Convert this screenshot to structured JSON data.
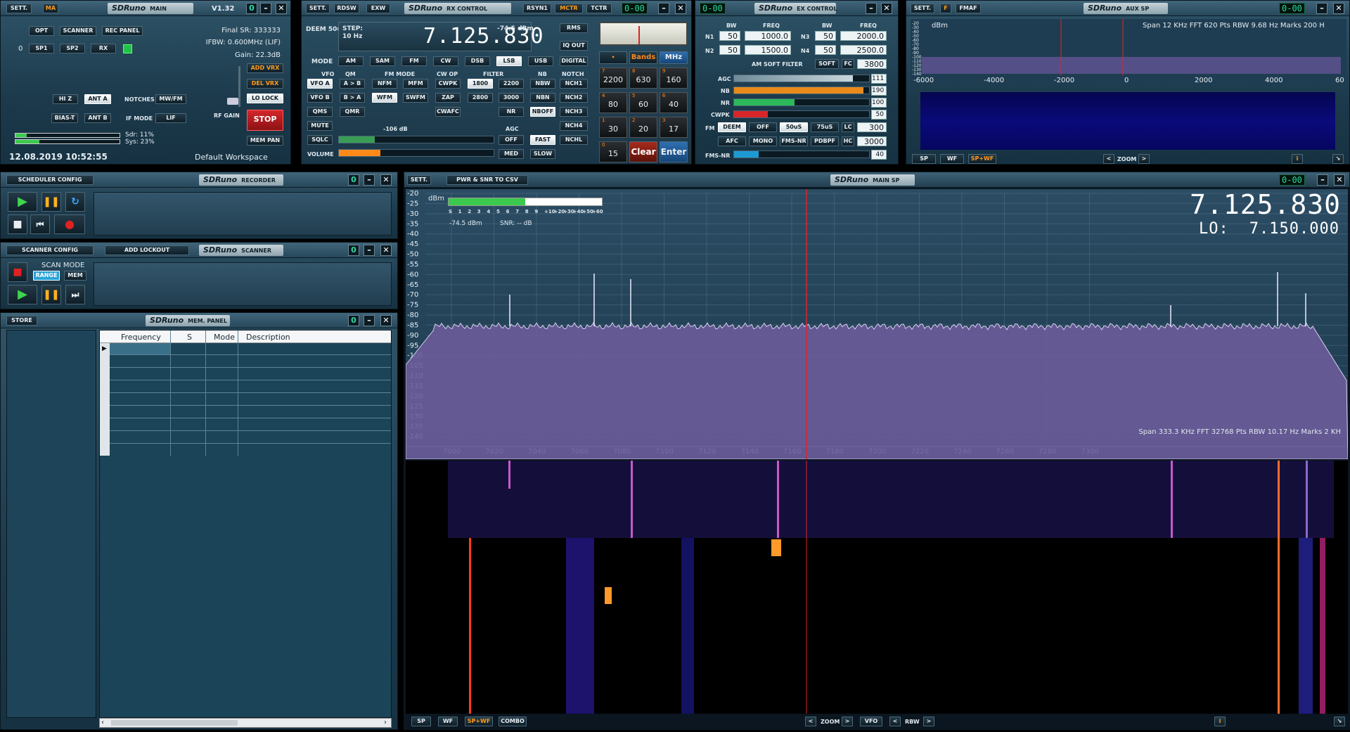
{
  "main": {
    "sett": "SETT.",
    "ma": "MA",
    "logo": "SDRuno",
    "title": "MAIN",
    "version": "V1.32",
    "opt": "OPT",
    "scanner": "SCANNER",
    "rec_panel": "REC PANEL",
    "num0": "0",
    "sp1": "SP1",
    "sp2": "SP2",
    "rx": "RX",
    "final_sr": "Final SR: 333333",
    "ifbw": "IFBW: 0.600MHz (LIF)",
    "gain": "Gain: 22.3dB",
    "add_vrx": "ADD VRX",
    "del_vrx": "DEL VRX",
    "lo_lock": "LO LOCK",
    "hiz": "HI Z",
    "ant_a": "ANT A",
    "notches": "NOTCHES",
    "mwfm": "MW/FM",
    "bias_t": "BIAS-T",
    "ant_b": "ANT B",
    "if_mode": "IF MODE",
    "lif": "LIF",
    "rf_gain": "RF GAIN",
    "stop": "STOP",
    "mem_pan": "MEM PAN",
    "sdr": "Sdr: 11%",
    "sys": "Sys: 23%",
    "sdr_level": 0.11,
    "sys_level": 0.23,
    "datetime": "12.08.2019 10:52:55",
    "workspace": "Default Workspace"
  },
  "rx": {
    "sett": "SETT.",
    "rdsw": "RDSW",
    "exw": "EXW",
    "logo": "SDRuno",
    "title": "RX CONTROL",
    "rsyn1": "RSYN1",
    "mctr": "MCTR",
    "tctr": "TCTR",
    "lcd": "0-00",
    "deem": "DEEM 50u",
    "step": "STEP:",
    "step_val": "10 Hz",
    "freq": "7.125.830",
    "dbm": "-74.5 dBm",
    "rms": "RMS",
    "iq_out": "IQ OUT",
    "mode": "MODE",
    "modes": [
      "AM",
      "SAM",
      "FM",
      "CW",
      "DSB",
      "LSB",
      "USB",
      "DIGITAL"
    ],
    "vfo": "VFO",
    "qm": "QM",
    "fm_mode": "FM MODE",
    "cw_op": "CW OP",
    "filter": "FILTER",
    "nb": "NB",
    "notch": "NOTCH",
    "vfo_a": "VFO A",
    "a_b": "A > B",
    "nfm": "NFM",
    "mfm": "MFM",
    "cwpk": "CWPK",
    "f1800": "1800",
    "f2200": "2200",
    "nbw": "NBW",
    "nch1": "NCH1",
    "vfo_b": "VFO B",
    "b_a": "B > A",
    "wfm": "WFM",
    "swfm": "SWFM",
    "zap": "ZAP",
    "f2800": "2800",
    "f3000": "3000",
    "nbn": "NBN",
    "nch2": "NCH2",
    "qms": "QMS",
    "qmr": "QMR",
    "cwafc": "CWAFC",
    "nr": "NR",
    "nboff": "NBOFF",
    "nch3": "NCH3",
    "mute": "MUTE",
    "sqlc_db": "-106 dB",
    "agc": "AGC",
    "nch4": "NCH4",
    "sqlc": "SQLC",
    "off": "OFF",
    "fast": "FAST",
    "nchl": "NCHL",
    "volume": "VOLUME",
    "med": "MED",
    "slow": "SLOW",
    "sqlc_level": 0.23,
    "volume_level": 0.27,
    "bands": "Bands",
    "mhz": "MHz",
    "keys": [
      {
        "k": "2200",
        "n": "7"
      },
      {
        "k": "630",
        "n": "8"
      },
      {
        "k": "160",
        "n": "9"
      },
      {
        "k": "80",
        "n": "4"
      },
      {
        "k": "60",
        "n": "5"
      },
      {
        "k": "40",
        "n": "6"
      },
      {
        "k": "30",
        "n": "1"
      },
      {
        "k": "20",
        "n": "2"
      },
      {
        "k": "17",
        "n": "3"
      },
      {
        "k": "15",
        "n": "0"
      }
    ],
    "clear": "Clear",
    "enter": "Enter"
  },
  "ex": {
    "lcd": "0-00",
    "logo": "SDRuno",
    "title": "EX CONTROL",
    "bw": "BW",
    "freq": "FREQ",
    "n1": "N1",
    "n1_bw": "50",
    "n1_freq": "1000.0",
    "n3": "N3",
    "n3_bw": "50",
    "n3_freq": "2000.0",
    "n2": "N2",
    "n2_bw": "50",
    "n2_freq": "1500.0",
    "n4": "N4",
    "n4_bw": "50",
    "n4_freq": "2500.0",
    "am_soft": "AM SOFT FILTER",
    "soft": "SOFT",
    "fc": "FC",
    "fc_val": "3800",
    "agc": "AGC",
    "agc_val": "111",
    "agc_level": 0.88,
    "nb": "NB",
    "nb_val": "190",
    "nb_level": 0.96,
    "nr": "NR",
    "nr_val": "100",
    "nr_level": 0.45,
    "cwpk": "CWPK",
    "cwpk_val": "50",
    "cwpk_level": 0.25,
    "fm": "FM",
    "deem": "DEEM",
    "off": "OFF",
    "us50": "50uS",
    "us75": "75uS",
    "lc": "LC",
    "lc_val": "300",
    "afc": "AFC",
    "mono": "MONO",
    "fmsnr": "FMS-NR",
    "pdbpf": "PDBPF",
    "hc": "HC",
    "hc_val": "3000",
    "fmsnr_label": "FMS-NR",
    "fmsnr_val": "40",
    "fmsnr_level": 0.18
  },
  "aux": {
    "sett": "SETT.",
    "f": "F",
    "fmaf": "FMAF",
    "logo": "SDRuno",
    "title": "AUX SP",
    "lcd": "0-00",
    "dbm": "dBm",
    "info": "Span 12 KHz   FFT 620 Pts   RBW 9.68 Hz   Marks 200 H",
    "y_ticks": [
      "-20",
      "-30",
      "-40",
      "-50",
      "-60",
      "-70",
      "-80",
      "-90",
      "-100",
      "-110",
      "-120",
      "-130",
      "-140"
    ],
    "x_ticks": [
      "-6000",
      "-4000",
      "-2000",
      "0",
      "2000",
      "4000",
      "60"
    ],
    "sp": "SP",
    "wf": "WF",
    "spwf": "SP+WF",
    "zoom": "ZOOM",
    "i": "i"
  },
  "recorder": {
    "scheduler": "SCHEDULER CONFIG",
    "logo": "SDRuno",
    "title": "RECORDER"
  },
  "scanner": {
    "config": "SCANNER CONFIG",
    "add_lockout": "ADD LOCKOUT",
    "logo": "SDRuno",
    "title": "SCANNER",
    "scan_mode": "SCAN MODE",
    "range": "RANGE",
    "mem": "MEM"
  },
  "mem": {
    "store": "STORE",
    "logo": "SDRuno",
    "title": "MEM. PANEL",
    "col_frequency": "Frequency",
    "col_s": "S",
    "col_mode": "Mode",
    "col_description": "Description"
  },
  "mainsp": {
    "sett": "SETT.",
    "pwr_snr": "PWR & SNR TO CSV",
    "logo": "SDRuno",
    "title": "MAIN SP",
    "lcd": "0-00",
    "dbm": "dBm",
    "meter_ticks": [
      "S",
      "1",
      "2",
      "3",
      "4",
      "5",
      "6",
      "7",
      "8",
      "9",
      "+10",
      "+20",
      "+30",
      "+40",
      "+50",
      "+60"
    ],
    "meter_level": 0.5,
    "level": "-74.5 dBm",
    "snr": "SNR: -- dB",
    "freq": "7.125.830",
    "lo_label": "LO:",
    "lo_freq": "7.150.000",
    "y_ticks": [
      "-20",
      "-25",
      "-30",
      "-35",
      "-40",
      "-45",
      "-50",
      "-55",
      "-60",
      "-65",
      "-70",
      "-75",
      "-80",
      "-85",
      "-90",
      "-95",
      "-100",
      "-105",
      "-110",
      "-115",
      "-120",
      "-125",
      "-130",
      "-135",
      "-140"
    ],
    "x_ticks": [
      "7000",
      "7020",
      "7040",
      "7060",
      "7080",
      "7100",
      "7120",
      "7140",
      "7160",
      "7180",
      "7200",
      "7220",
      "7240",
      "7260",
      "7280",
      "7300"
    ],
    "info": "Span 333.3 KHz   FFT 32768 Pts   RBW 10.17 Hz   Marks 2 KH",
    "sp": "SP",
    "wf": "WF",
    "spwf": "SP+WF",
    "combo": "COMBO",
    "zoom": "ZOOM",
    "vfo": "VFO",
    "rbw": "RBW",
    "i": "i"
  },
  "colors": {
    "accent_orange": "#ff9a1a",
    "panel": "#1c3a4c",
    "spectrum_fill": "#6b5c9a",
    "tuning_line": "#d8262a"
  }
}
